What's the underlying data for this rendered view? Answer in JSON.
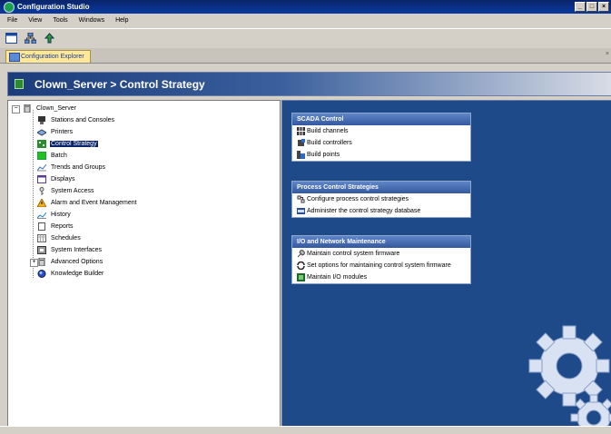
{
  "window": {
    "title": "Configuration Studio"
  },
  "menu": [
    "File",
    "View",
    "Tools",
    "Windows",
    "Help"
  ],
  "tab": {
    "label": "Configuration Explorer"
  },
  "header": {
    "title": "Clown_Server > Control Strategy"
  },
  "tree": {
    "root": "Clown_Server",
    "items": [
      "Stations and Consoles",
      "Printers",
      "Control Strategy",
      "Batch",
      "Trends and Groups",
      "Displays",
      "System Access",
      "Alarm and Event Management",
      "History",
      "Reports",
      "Schedules",
      "System Interfaces",
      "Advanced Options",
      "Knowledge Builder"
    ],
    "selected": "Control Strategy"
  },
  "panels": [
    {
      "title": "SCADA Control",
      "items": [
        "Build channels",
        "Build controllers",
        "Build points"
      ]
    },
    {
      "title": "Process Control Strategies",
      "items": [
        "Configure process control strategies",
        "Administer the control strategy database"
      ]
    },
    {
      "title": "I/O and Network Maintenance",
      "items": [
        "Maintain control system firmware",
        "Set options for maintaining control system firmware",
        "Maintain I/O modules"
      ]
    }
  ],
  "colors": {
    "accent": "#0a246a",
    "panel_bg": "#1e4a8a",
    "header_blue": "#1c3c7a"
  }
}
